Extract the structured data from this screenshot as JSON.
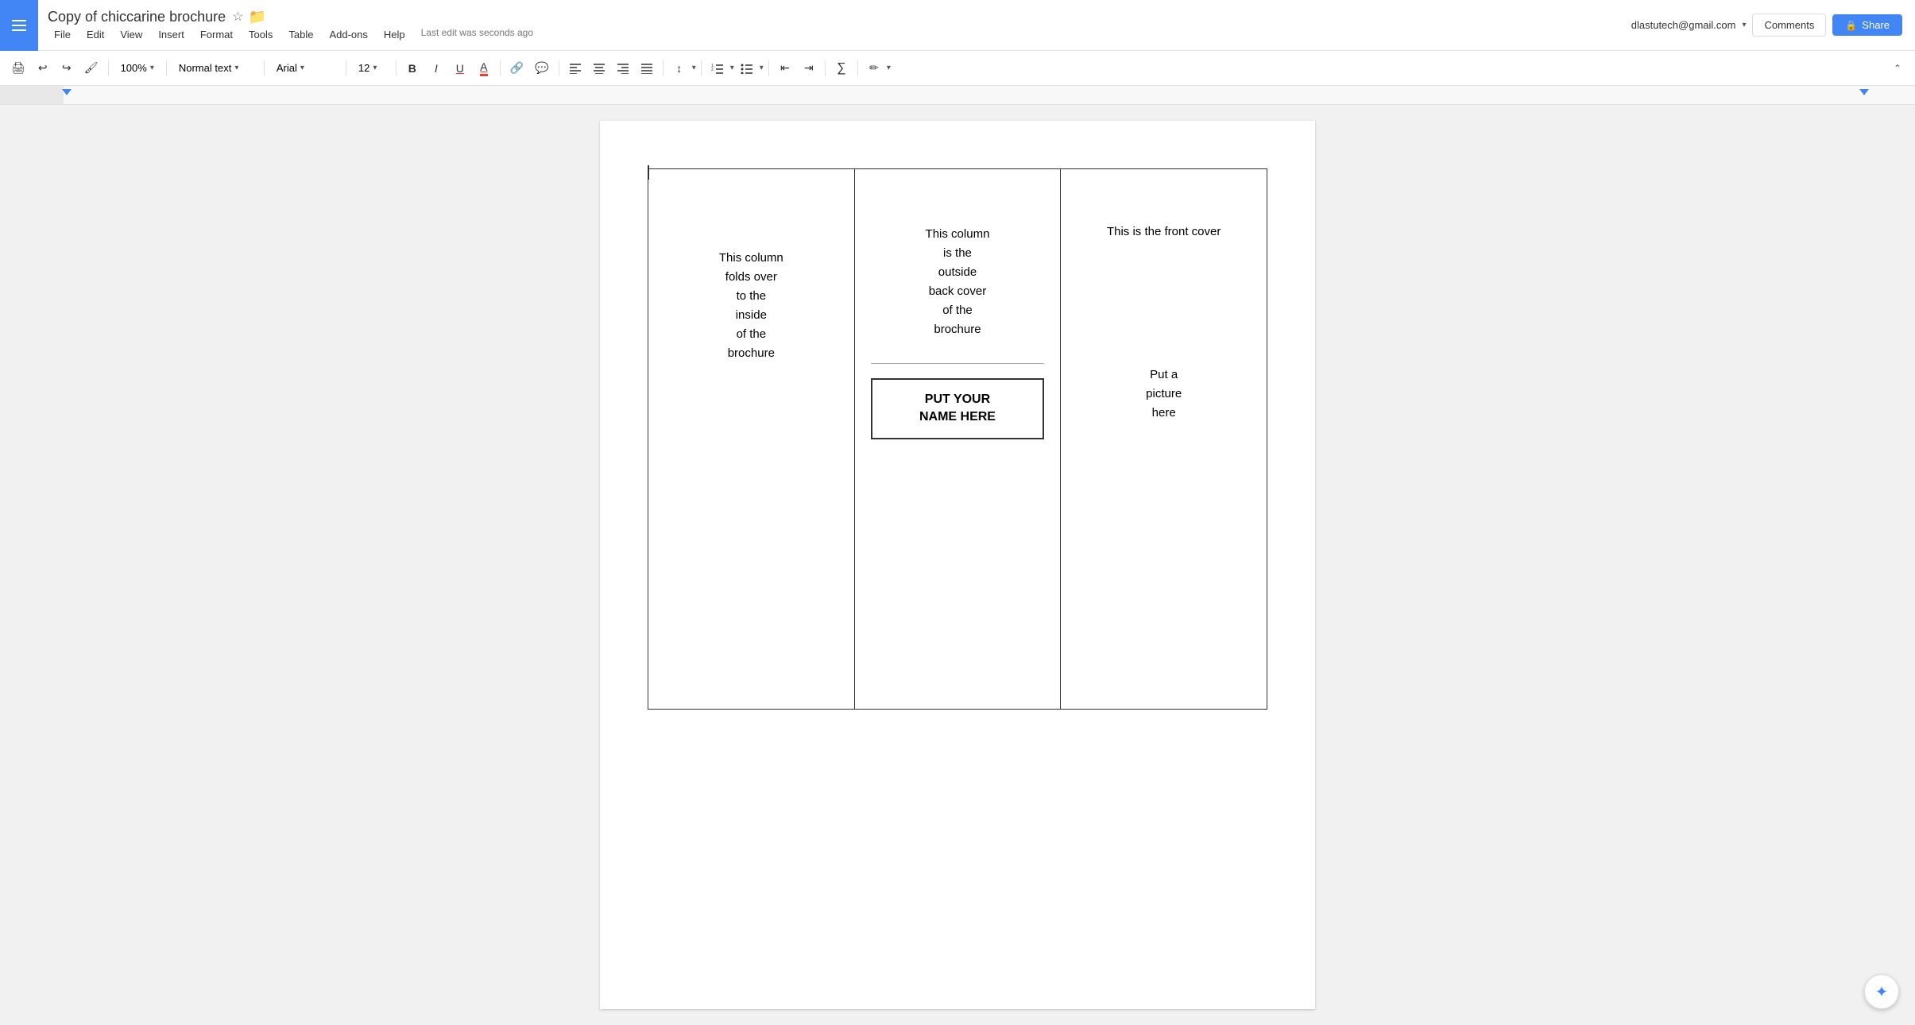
{
  "app": {
    "google_apps_icon": "☰",
    "doc_title": "Copy of chiccarine brochure",
    "star_icon": "☆",
    "folder_icon": "▬",
    "user_email": "dlastutech@gmail.com",
    "dropdown_arrow": "▾",
    "comments_label": "Comments",
    "share_label": "Share",
    "lock_icon": "🔒",
    "last_edit": "Last edit was seconds ago"
  },
  "menu": {
    "items": [
      {
        "label": "File"
      },
      {
        "label": "Edit"
      },
      {
        "label": "View"
      },
      {
        "label": "Insert"
      },
      {
        "label": "Format"
      },
      {
        "label": "Tools"
      },
      {
        "label": "Table"
      },
      {
        "label": "Add-ons"
      },
      {
        "label": "Help"
      }
    ]
  },
  "toolbar": {
    "print_icon": "🖨",
    "undo_icon": "↩",
    "redo_icon": "↪",
    "paint_format_icon": "🖌",
    "zoom_value": "100%",
    "zoom_arrow": "▾",
    "style_value": "Normal text",
    "style_arrow": "▾",
    "font_value": "Arial",
    "font_arrow": "▾",
    "size_value": "12",
    "size_arrow": "▾",
    "bold_label": "B",
    "italic_label": "I",
    "underline_label": "U",
    "text_color_label": "A",
    "link_icon": "🔗",
    "comment_icon": "💬",
    "align_left": "≡",
    "align_center": "≡",
    "align_right": "≡",
    "align_justify": "≡",
    "line_spacing_icon": "↕",
    "numbered_list_icon": "≔",
    "bullet_list_icon": "≔",
    "indent_left_icon": "⇤",
    "indent_right_icon": "⇥",
    "functions_icon": "∑",
    "pen_icon": "✏",
    "collapse_icon": "⌃"
  },
  "document": {
    "col1": {
      "text": "This column\nfolds over\nto the\ninside\nof the\nbrochure"
    },
    "col2": {
      "top_text": "This column\nis the\noutside\nback cover\nof the\nbrochure",
      "name_box_line1": "PUT YOUR",
      "name_box_line2": "NAME HERE"
    },
    "col3": {
      "top_text": "This is the front cover",
      "bottom_text": "Put a\npicture\nhere"
    }
  }
}
